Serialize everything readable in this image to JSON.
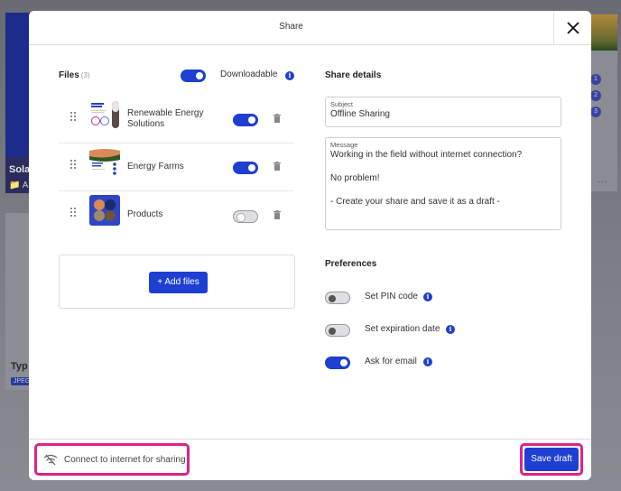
{
  "background": {
    "left_top_card": {
      "title": "Sola",
      "subtitle": "A"
    },
    "left_bottom_card": {
      "title": "Typ",
      "tag": "JPEG"
    },
    "right_card": {
      "badges": [
        "1",
        "2",
        "3"
      ],
      "more": "..."
    }
  },
  "modal": {
    "title": "Share",
    "close_icon": "close-icon"
  },
  "files": {
    "heading": "Files",
    "count": "(3)",
    "downloadable_label": "Downloadable",
    "downloadable_on": true,
    "items": [
      {
        "name_line1": "Renewable Energy",
        "name_line2": "Solutions",
        "enabled": true
      },
      {
        "name_line1": "Energy Farms",
        "name_line2": "",
        "enabled": true
      },
      {
        "name_line1": "Products",
        "name_line2": "",
        "enabled": false
      }
    ],
    "add_button": "+ Add files"
  },
  "share_details": {
    "heading": "Share details",
    "subject_label": "Subject",
    "subject_value": "Offline Sharing",
    "message_label": "Message",
    "message_lines": [
      "Working in the field without internet connection?",
      "",
      "No problem!",
      "",
      "- Create your share and save it as a draft -"
    ]
  },
  "preferences": {
    "heading": "Preferences",
    "items": [
      {
        "label": "Set PIN code",
        "enabled": false
      },
      {
        "label": "Set expiration date",
        "enabled": false
      },
      {
        "label": "Ask for email",
        "enabled": true
      }
    ]
  },
  "footer": {
    "offline_message": "Connect to internet for sharing",
    "save_button": "Save draft"
  },
  "colors": {
    "accent": "#1f3fd2",
    "highlight": "#e0218a"
  }
}
